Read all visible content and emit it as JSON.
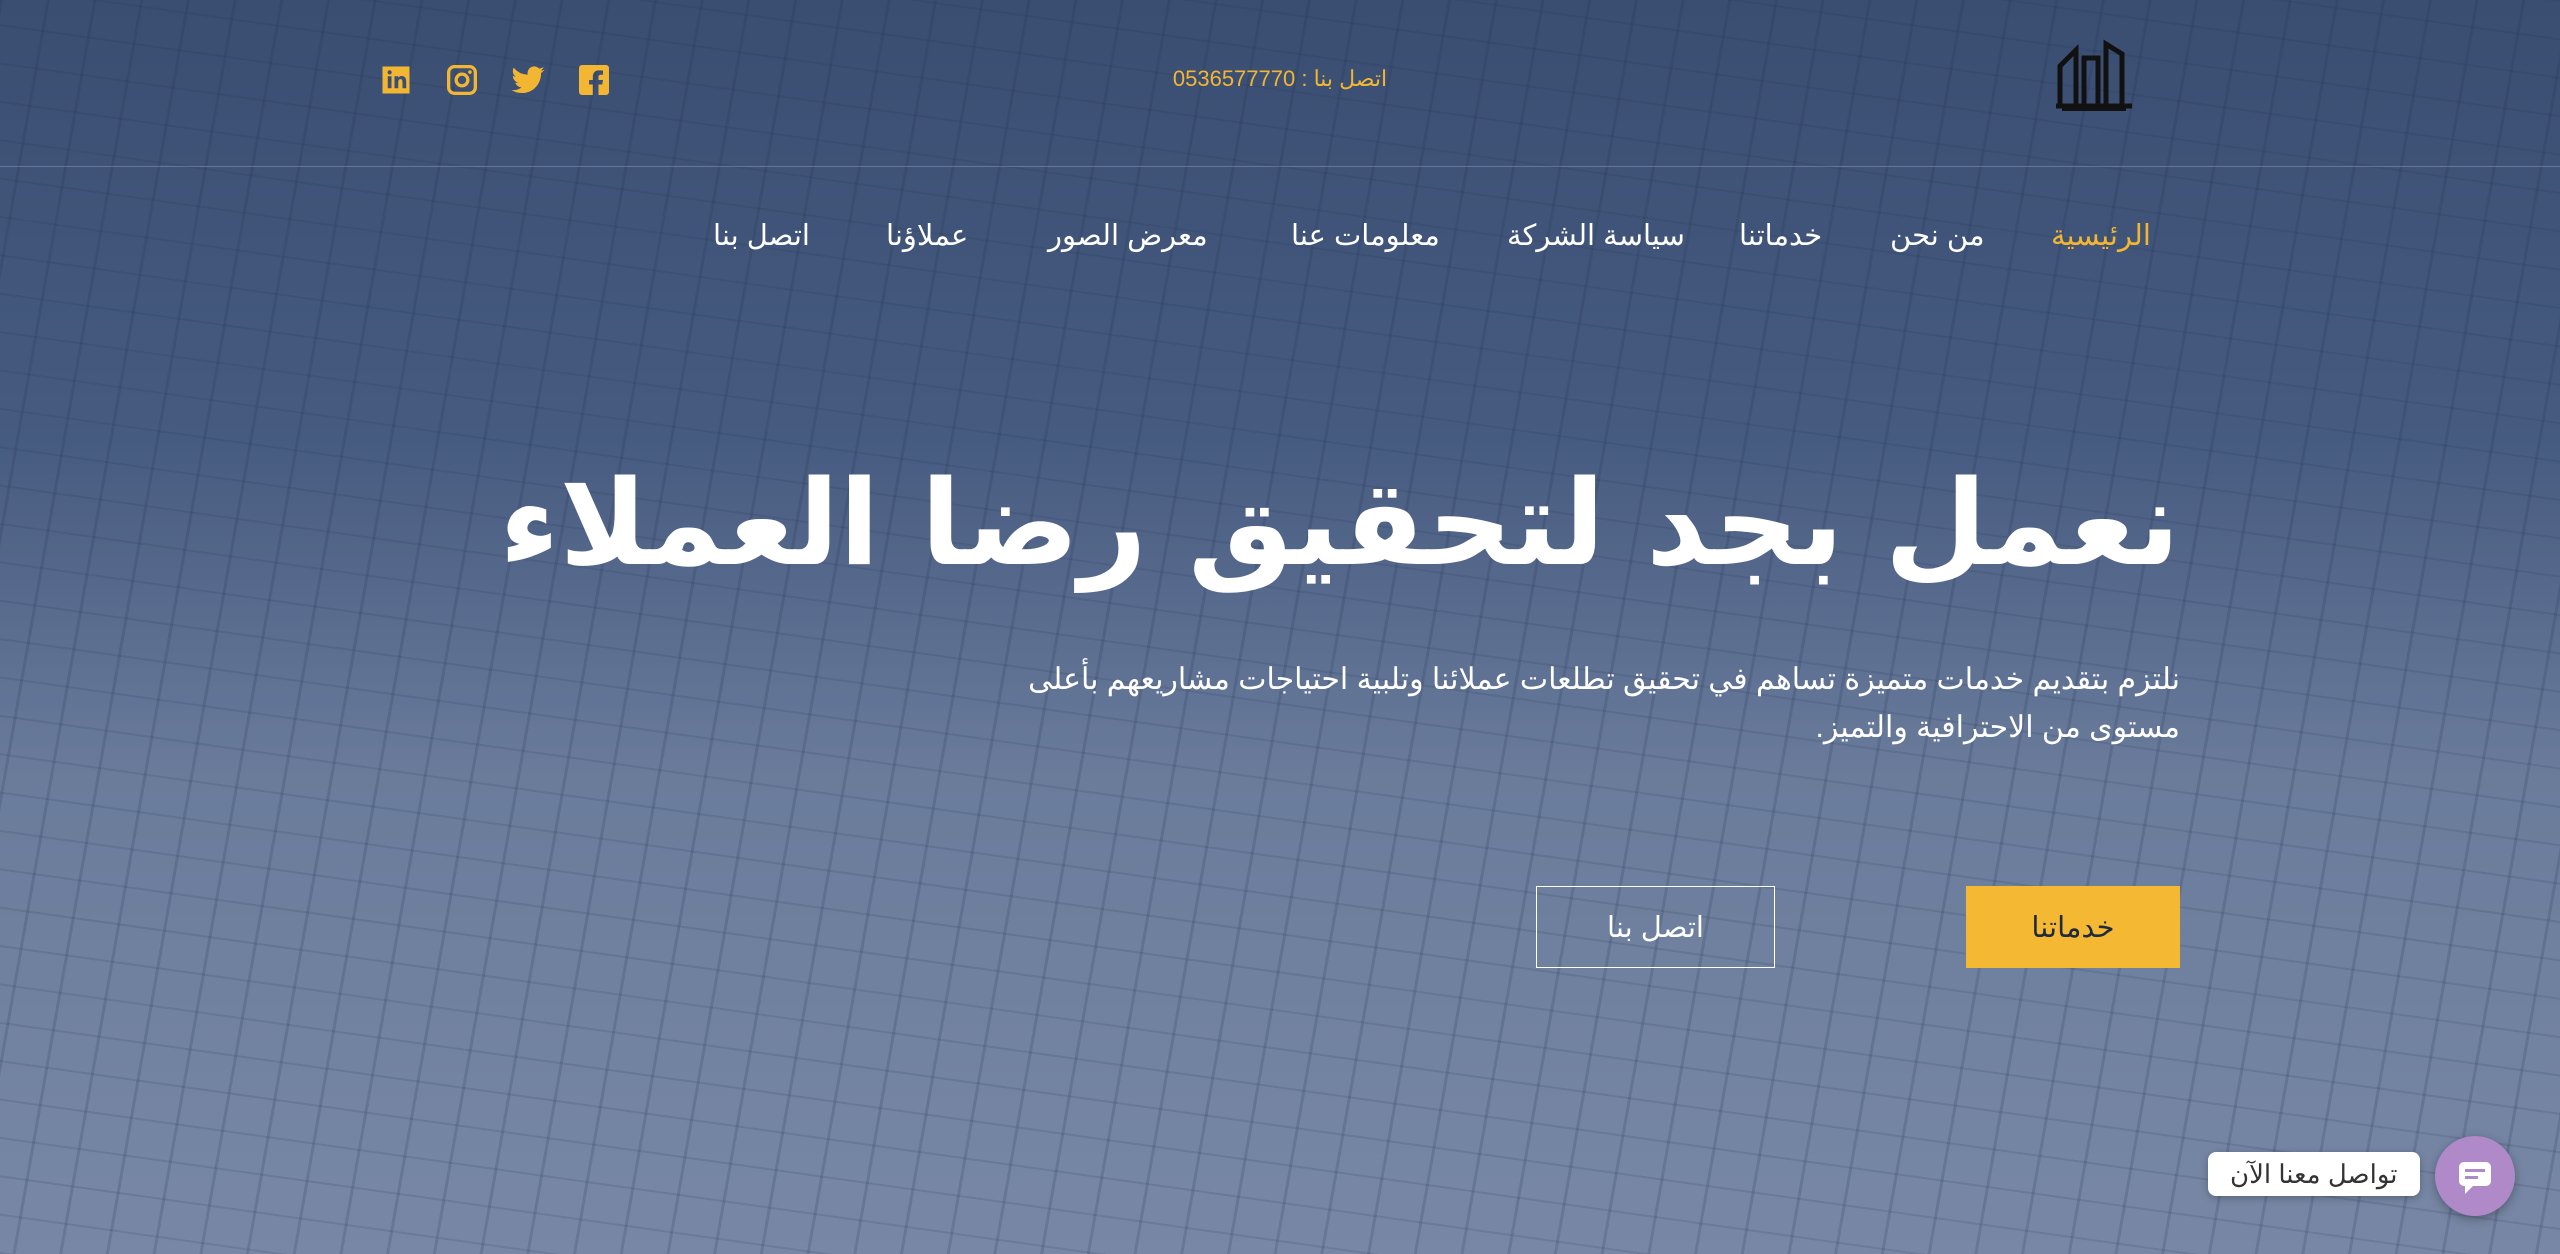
{
  "header": {
    "phone_text": "اتصل بنا : 0536577770",
    "socials": [
      {
        "icon": "linkedin-icon"
      },
      {
        "icon": "instagram-icon"
      },
      {
        "icon": "twitter-icon"
      },
      {
        "icon": "facebook-icon"
      }
    ],
    "accent_color": "#f2b632"
  },
  "nav": {
    "items": [
      {
        "label": "الرئيسية",
        "active": true
      },
      {
        "label": "من نحن"
      },
      {
        "label": "خدماتنا"
      },
      {
        "label": "سياسة الشركة"
      },
      {
        "label": "معلومات عنا"
      },
      {
        "label": "معرض الصور"
      },
      {
        "label": "عملاؤنا"
      },
      {
        "label": "اتصل بنا"
      }
    ]
  },
  "hero": {
    "headline": "نعمل بجد لتحقيق رضا العملاء",
    "subtext": "نلتزم بتقديم خدمات متميزة تساهم في تحقيق تطلعات عملائنا وتلبية احتياجات مشاريعهم بأعلى مستوى من الاحترافية والتميز.",
    "primary_button": "خدماتنا",
    "secondary_button": "اتصل بنا"
  },
  "chat": {
    "label": "تواصل معنا الآن",
    "icon": "chat-icon",
    "color": "#b089c8"
  }
}
